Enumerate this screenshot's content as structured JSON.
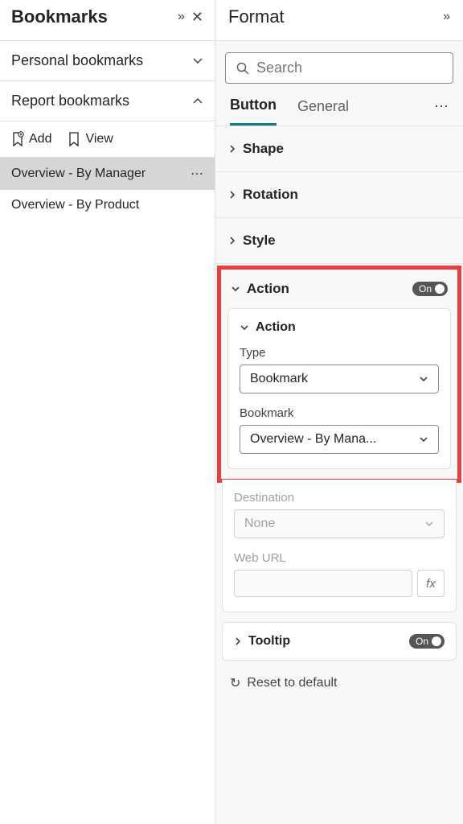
{
  "bookmarks_panel": {
    "title": "Bookmarks",
    "personal_label": "Personal bookmarks",
    "report_label": "Report bookmarks",
    "add_label": "Add",
    "view_label": "View",
    "items": [
      {
        "label": "Overview - By Manager",
        "selected": true
      },
      {
        "label": "Overview - By Product",
        "selected": false
      }
    ]
  },
  "format_panel": {
    "title": "Format",
    "search_placeholder": "Search",
    "tabs": {
      "button": "Button",
      "general": "General"
    },
    "groups": {
      "shape": "Shape",
      "rotation": "Rotation",
      "style": "Style",
      "action": "Action",
      "tooltip": "Tooltip"
    },
    "action_toggle": "On",
    "tooltip_toggle": "On",
    "action_card": {
      "subheader": "Action",
      "type_label": "Type",
      "type_value": "Bookmark",
      "bookmark_label": "Bookmark",
      "bookmark_value": "Overview - By Mana...",
      "destination_label": "Destination",
      "destination_value": "None",
      "weburl_label": "Web URL",
      "fx_label": "fx"
    },
    "reset_label": "Reset to default"
  }
}
